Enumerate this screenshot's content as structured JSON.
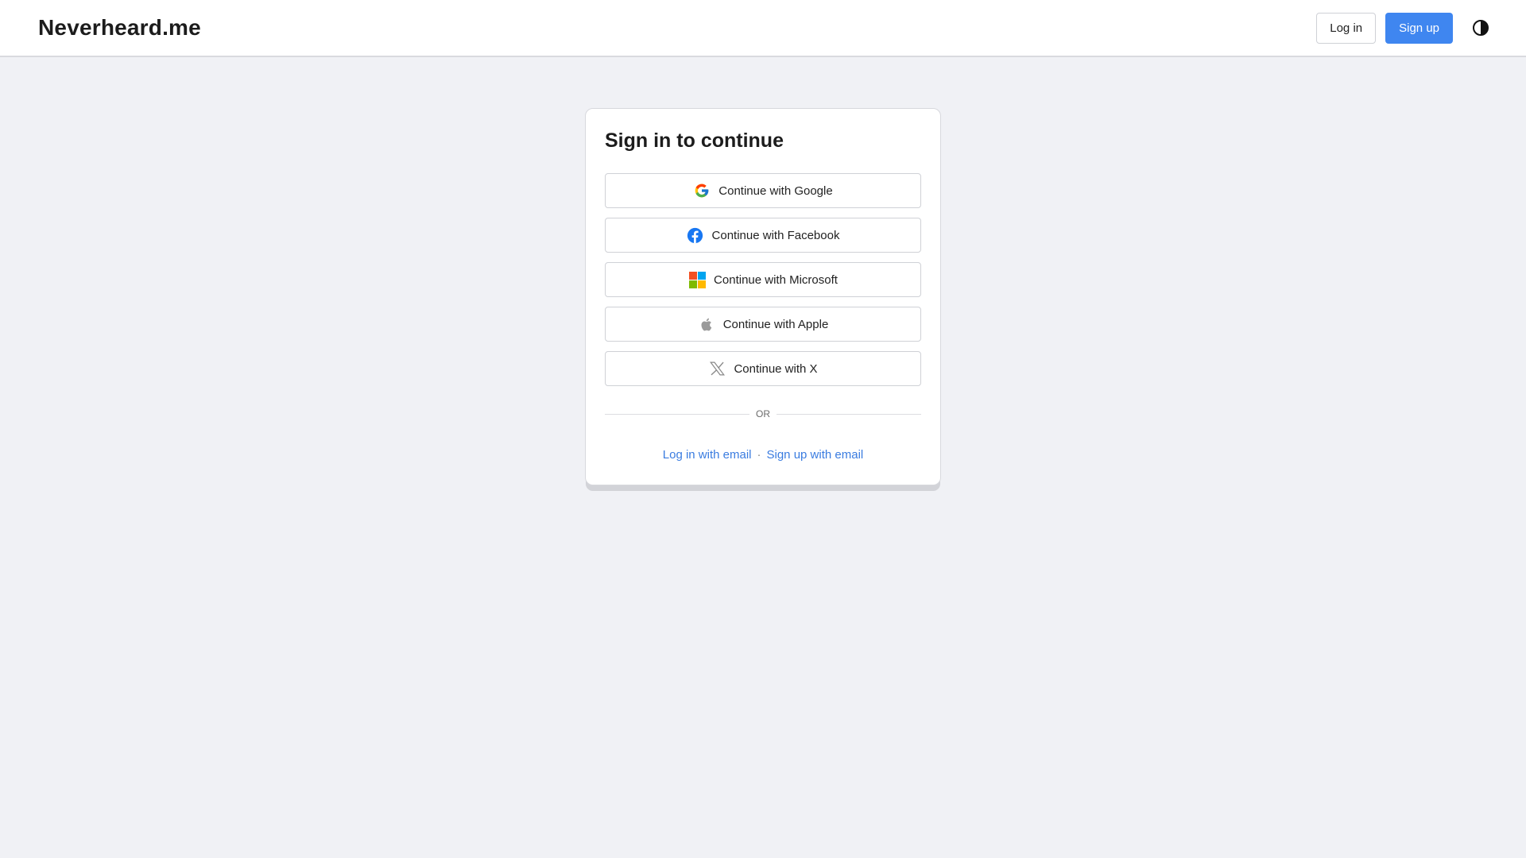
{
  "header": {
    "brand": "Neverheard.me",
    "login_label": "Log in",
    "signup_label": "Sign up",
    "theme_icon": "contrast-icon"
  },
  "card": {
    "title": "Sign in to continue",
    "providers": [
      {
        "label": "Continue with Google",
        "icon": "google-icon"
      },
      {
        "label": "Continue with Facebook",
        "icon": "facebook-icon"
      },
      {
        "label": "Continue with Microsoft",
        "icon": "microsoft-icon"
      },
      {
        "label": "Continue with Apple",
        "icon": "apple-icon"
      },
      {
        "label": "Continue with X",
        "icon": "x-icon"
      }
    ],
    "divider_text": "OR",
    "email_login_label": "Log in with email",
    "separator": "·",
    "email_signup_label": "Sign up with email"
  },
  "colors": {
    "accent": "#3f86f0",
    "link": "#3a7ce0",
    "background": "#f0f1f5"
  }
}
